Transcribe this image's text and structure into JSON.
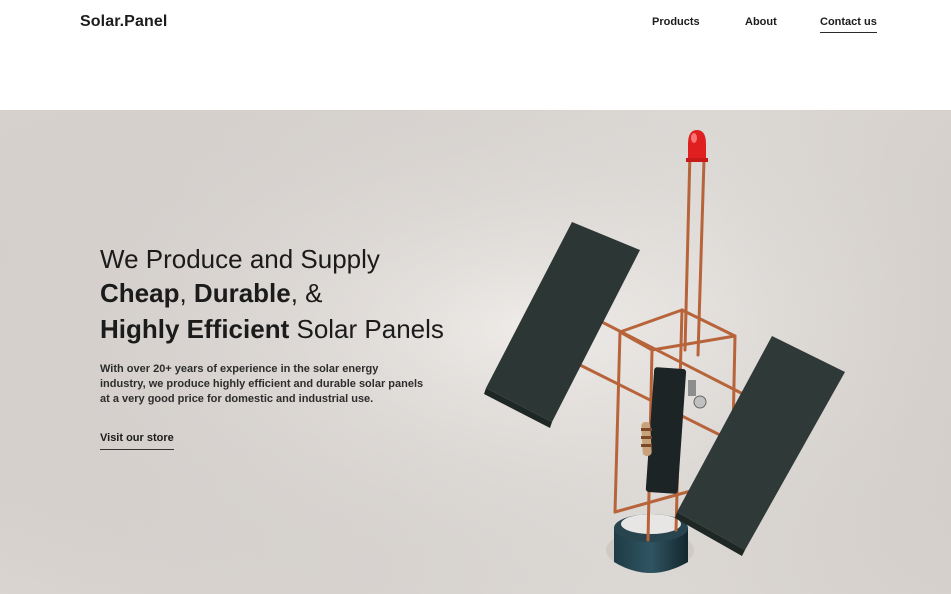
{
  "header": {
    "logo": "Solar.Panel",
    "nav": [
      {
        "label": "Products"
      },
      {
        "label": "About"
      },
      {
        "label": "Contact us"
      }
    ]
  },
  "hero": {
    "headline_line1": "We Produce and Supply",
    "headline_line2": {
      "w1": "Cheap",
      "sep1": ", ",
      "w2": "Durable",
      "sep2": ", &"
    },
    "headline_line3": {
      "w1": "Highly Efficient",
      "rest": " Solar Panels"
    },
    "description": [
      "With over 20+ years of experience in the solar energy",
      "industry, we produce highly efficient and durable solar panels",
      "at a very good price for domestic and industrial use."
    ],
    "cta_label": "Visit our store"
  },
  "colors": {
    "background": "#ffffff",
    "hero_bg": "#e7e2de",
    "panel": "#2f3a38",
    "copper": "#b8643a",
    "led": "#e02020"
  }
}
